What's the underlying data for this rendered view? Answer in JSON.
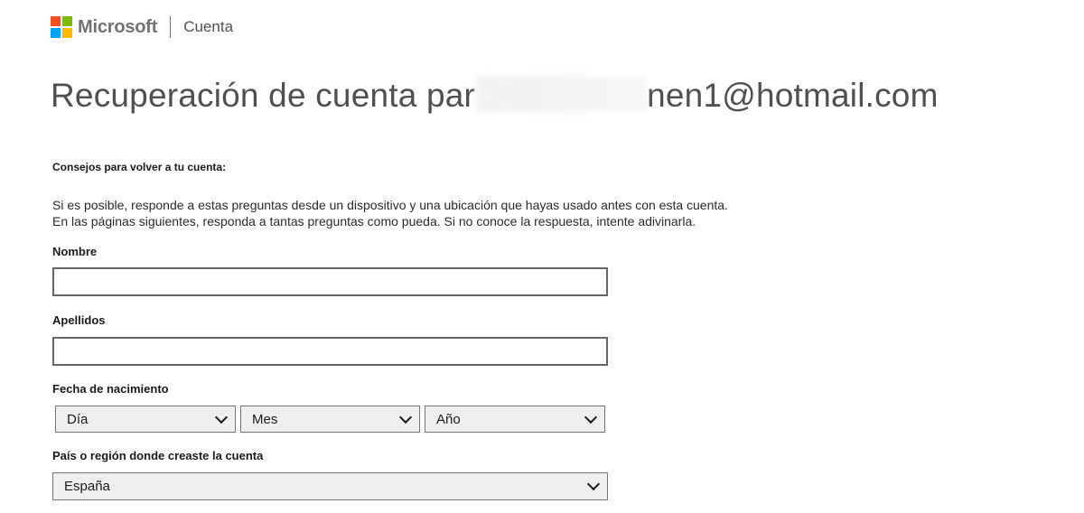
{
  "header": {
    "brand": "Microsoft",
    "section": "Cuenta"
  },
  "title": {
    "prefix": "Recuperación de cuenta par",
    "suffix": "nen1@hotmail.com"
  },
  "tips": {
    "heading": "Consejos para volver a tu cuenta:",
    "line1": "Si es posible, responde a estas preguntas desde un dispositivo y una ubicación que hayas usado antes con esta cuenta.",
    "line2": "En las páginas siguientes, responda a tantas preguntas como pueda. Si no conoce la respuesta, intente adivinarla."
  },
  "form": {
    "first_name_label": "Nombre",
    "first_name_value": "",
    "last_name_label": "Apellidos",
    "last_name_value": "",
    "birthdate_label": "Fecha de nacimiento",
    "day_selected": "Día",
    "month_selected": "Mes",
    "year_selected": "Año",
    "country_label": "País o región donde creaste la cuenta",
    "country_selected": "España"
  },
  "colors": {
    "logo_red": "#f25022",
    "logo_green": "#7fba00",
    "logo_blue": "#00a4ef",
    "logo_yellow": "#ffb900"
  }
}
